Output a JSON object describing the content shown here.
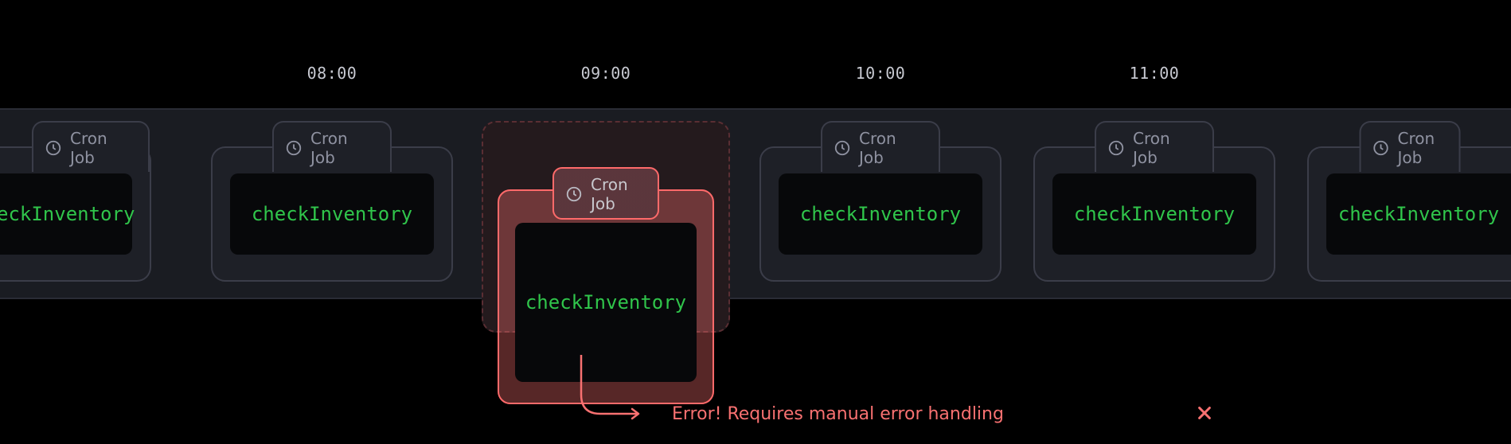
{
  "times": [
    "08:00",
    "09:00",
    "10:00",
    "11:00"
  ],
  "cron": {
    "tab_label": "Cron Job",
    "fn": "checkInventory"
  },
  "clipped_fn_visible": "eckInventory",
  "error": {
    "message": "Error! Requires manual error handling"
  }
}
